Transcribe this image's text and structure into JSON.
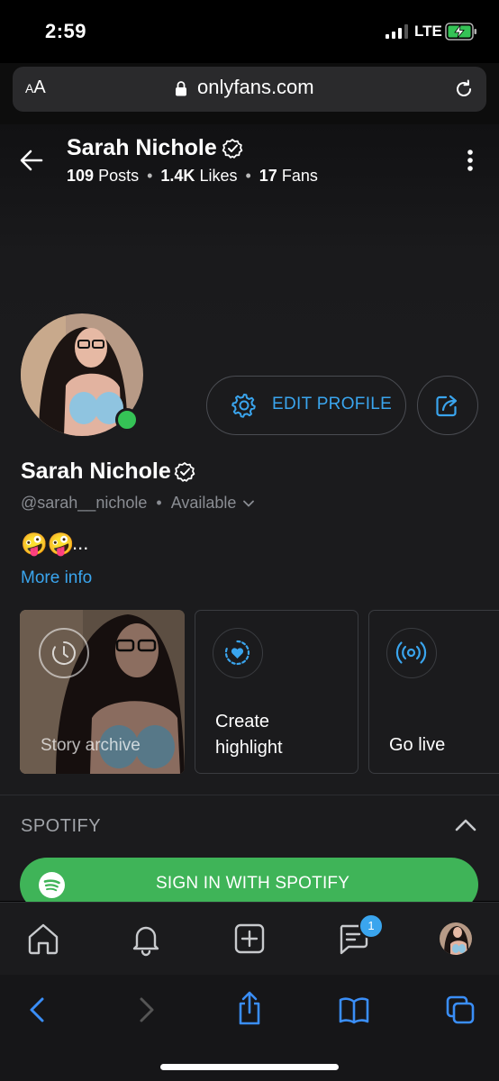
{
  "status_bar": {
    "time": "2:59",
    "network": "LTE"
  },
  "browser": {
    "text_size_label_small": "A",
    "text_size_label_big": "A",
    "url": "onlyfans.com"
  },
  "header": {
    "name": "Sarah Nichole",
    "posts_count": "109",
    "posts_label": "Posts",
    "likes_count": "1.4K",
    "likes_label": "Likes",
    "fans_count": "17",
    "fans_label": "Fans"
  },
  "profile": {
    "name": "Sarah Nichole",
    "handle": "@sarah__nichole",
    "availability": "Available",
    "bio_emoji": "🤪🤪",
    "bio_ellipsis": "...",
    "more_info_label": "More info",
    "edit_profile_label": "EDIT PROFILE",
    "online": true
  },
  "highlights": {
    "story_archive_label": "Story archive",
    "create_highlight_label": "Create highlight",
    "go_live_label": "Go live"
  },
  "spotify": {
    "section_title": "SPOTIFY",
    "sign_in_label": "SIGN IN WITH SPOTIFY"
  },
  "bottom_nav": {
    "items": [
      "home-icon",
      "bell-icon",
      "plus-square-icon",
      "messages-icon",
      "avatar"
    ],
    "messages_badge": "1"
  },
  "safari_toolbar": {
    "items": [
      "back-icon",
      "forward-icon",
      "share-icon",
      "bookmarks-icon",
      "tabs-icon"
    ]
  },
  "colors": {
    "accent": "#3aa5ee",
    "online": "#35c356",
    "spotify": "#3fb458",
    "background": "#1b1b1d"
  }
}
